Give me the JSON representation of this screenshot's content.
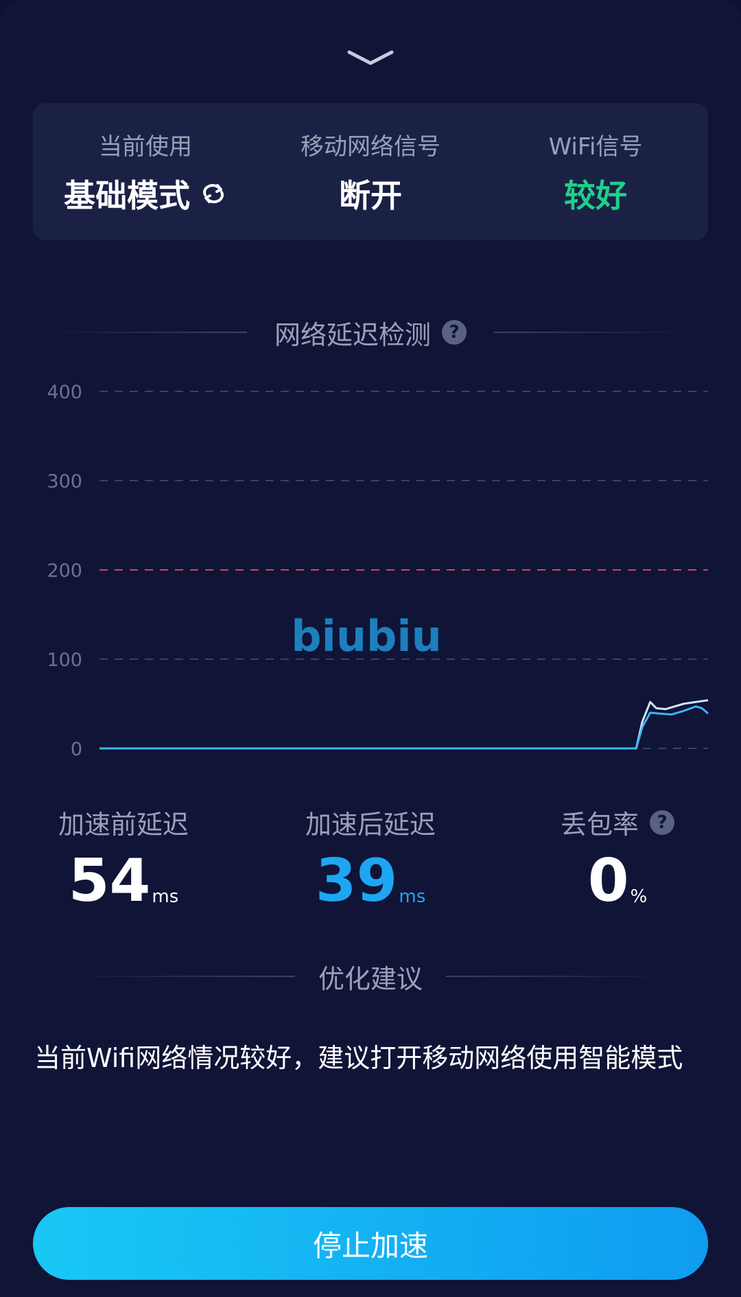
{
  "status_card": {
    "mode_label": "当前使用",
    "mode_value": "基础模式",
    "mobile_label": "移动网络信号",
    "mobile_value": "断开",
    "wifi_label": "WiFi信号",
    "wifi_value": "较好"
  },
  "latency_section": {
    "title": "网络延迟检测"
  },
  "watermark": "biubiu",
  "chart_data": {
    "type": "line",
    "y_ticks": [
      "400",
      "300",
      "200",
      "100",
      "0"
    ],
    "ylim": [
      0,
      400
    ],
    "xlim": [
      0,
      100
    ],
    "threshold": 200,
    "grid": true,
    "series": [
      {
        "color": "#cfe6ff",
        "points": [
          [
            0,
            0
          ],
          [
            88.2,
            0
          ],
          [
            89.2,
            30
          ],
          [
            90.5,
            52
          ],
          [
            91.5,
            45
          ],
          [
            93,
            44
          ],
          [
            94.5,
            47
          ],
          [
            96,
            50
          ],
          [
            98,
            52
          ],
          [
            100,
            54
          ]
        ]
      },
      {
        "color": "#3bb8f5",
        "points": [
          [
            0,
            0
          ],
          [
            88.2,
            0
          ],
          [
            89.2,
            24
          ],
          [
            90.5,
            40
          ],
          [
            92,
            39
          ],
          [
            94,
            38
          ],
          [
            96,
            42
          ],
          [
            98,
            47
          ],
          [
            99,
            45
          ],
          [
            100,
            39
          ]
        ]
      }
    ],
    "colors": {
      "grid": "#3a406a",
      "threshold": "#c94a5a",
      "tick": "#6c7294"
    }
  },
  "metrics": {
    "before_label": "加速前延迟",
    "before_value": "54",
    "before_unit": "ms",
    "after_label": "加速后延迟",
    "after_value": "39",
    "after_unit": "ms",
    "loss_label": "丢包率",
    "loss_value": "0",
    "loss_unit": "%"
  },
  "suggestion_section": {
    "title": "优化建议",
    "text": "当前Wifi网络情况较好，建议打开移动网络使用智能模式"
  },
  "stop_button": {
    "label": "停止加速"
  },
  "help_icon_glyph": "?",
  "colors": {
    "background": "#101436",
    "card": "#1b2145",
    "good": "#1fd08a",
    "accent": "#1ea6f2",
    "button": "#19c8f5"
  }
}
